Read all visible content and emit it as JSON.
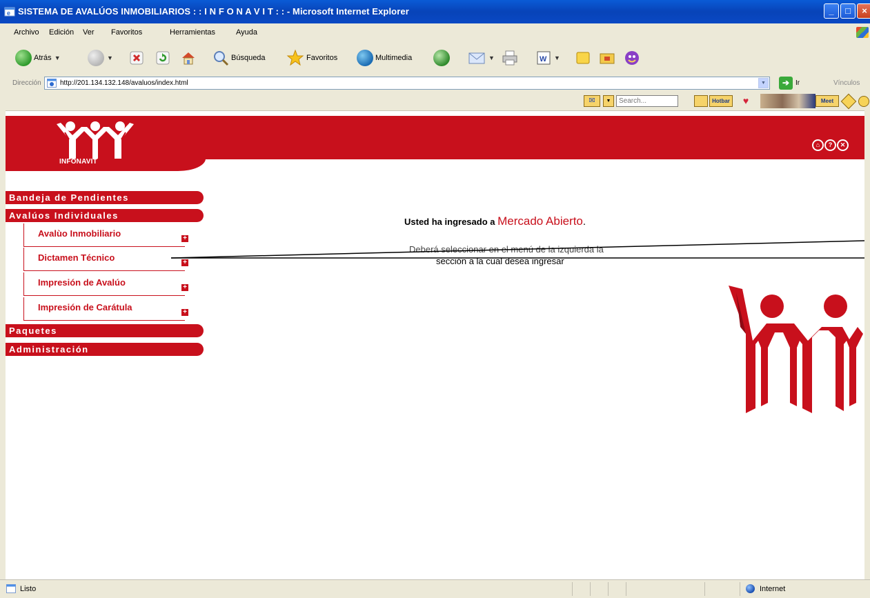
{
  "window": {
    "title": "SISTEMA DE AVALÚOS INMOBILIARIOS : : I N F O N A V I T : : - Microsoft Internet Explorer",
    "minimize": "_",
    "maximize": "□",
    "close": "×"
  },
  "menubar": {
    "items": [
      "Archivo",
      "Edición",
      "Ver",
      "Favoritos",
      "Herramientas",
      "Ayuda"
    ]
  },
  "toolbar": {
    "back": "Atrás",
    "search": "Búsqueda",
    "favorites": "Favoritos",
    "multimedia": "Multimedia"
  },
  "address": {
    "label": "Dirección",
    "url": "http://201.134.132.148/avaluos/index.html",
    "go": "Ir",
    "links": "Vínculos"
  },
  "extrabar": {
    "search_placeholder": "Search...",
    "hotbar": "Hotbar",
    "meet": "Meet"
  },
  "header": {
    "brand": "INFONAVIT",
    "icons": [
      "home-icon",
      "help-icon",
      "close-icon"
    ]
  },
  "sidebar": {
    "sections": [
      {
        "label": "Bandeja de Pendientes"
      },
      {
        "label": "Avalúos Individuales"
      },
      {
        "label": "Paquetes"
      },
      {
        "label": "Administración"
      }
    ],
    "subitems": [
      {
        "label": "Avalùo Inmobiliario"
      },
      {
        "label": "Dictamen Técnico"
      },
      {
        "label": "Impresión de Avalúo"
      },
      {
        "label": "Impresión de Carátula"
      }
    ],
    "plus_glyph": "+"
  },
  "main": {
    "welcome_prefix": "Usted ha ingresado a ",
    "site_name": "Mercado Abierto",
    "welcome_suffix": ".",
    "instruction_line1": "Deberá seleccionar en el menú de la izquierda la",
    "instruction_line2": "sección a la cual desea ingresar"
  },
  "statusbar": {
    "status": "Listo",
    "zone": "Internet"
  },
  "colors": {
    "brand_red": "#c8101c",
    "xp_blue": "#0843b8"
  }
}
